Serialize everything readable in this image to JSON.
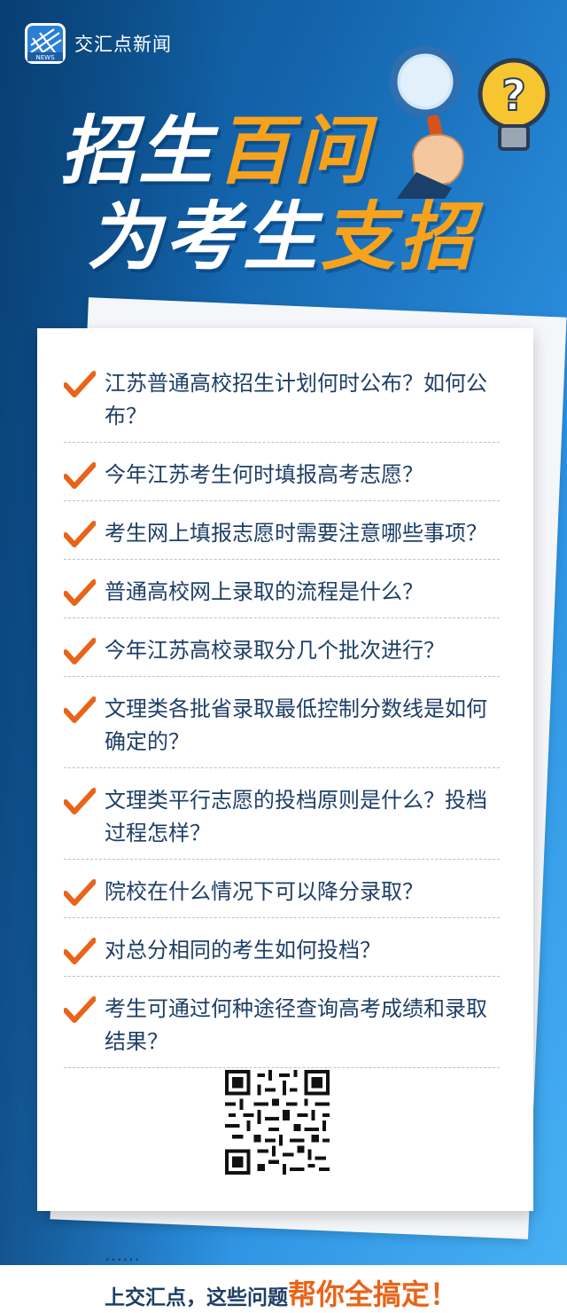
{
  "brand": {
    "name": "交汇点新闻",
    "logo_label": "NEWS"
  },
  "title": {
    "line1_white": "招生",
    "line1_orange": "百问",
    "line2_white": "为考生",
    "line2_orange": "支招"
  },
  "questions": [
    "江苏普通高校招生计划何时公布？如何公布？",
    "今年江苏考生何时填报高考志愿？",
    "考生网上填报志愿时需要注意哪些事项？",
    "普通高校网上录取的流程是什么？",
    "今年江苏高校录取分几个批次进行？",
    "文理类各批省录取最低控制分数线是如何确定的？",
    "文理类平行志愿的投档原则是什么？投档过程怎样？",
    "院校在什么情况下可以降分录取？",
    "对总分相同的考生如何投档？",
    "考生可通过何种途径查询高考成绩和录取结果？"
  ],
  "ellipsis": "……",
  "cta": {
    "plain": "上交汇点，这些问题",
    "highlight": "帮你全搞定！"
  },
  "colors": {
    "accent": "#f6a21c",
    "check": "#e86418",
    "text": "#1e3f66"
  }
}
